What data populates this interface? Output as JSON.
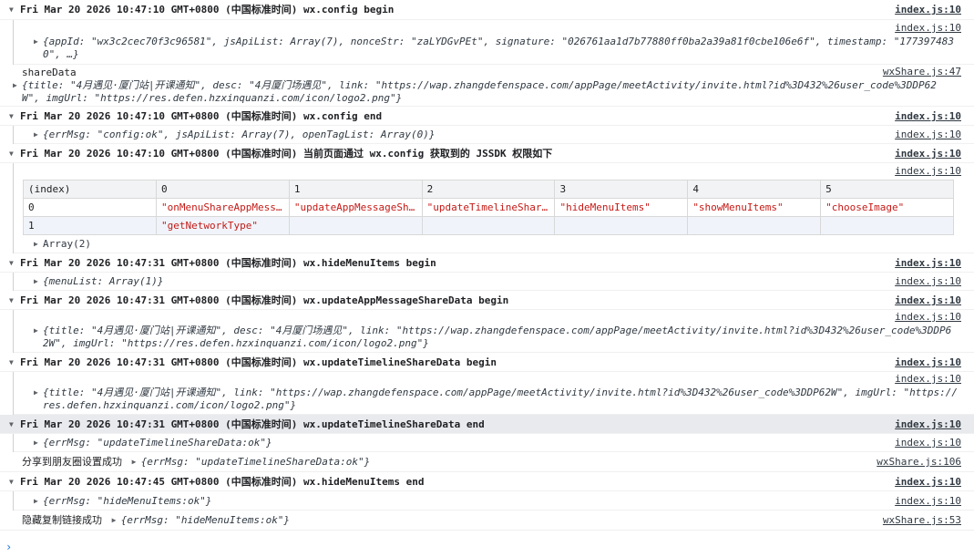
{
  "link_index": "index.js:10",
  "link_wxshare_47": "wxShare.js:47",
  "link_wxshare_106": "wxShare.js:106",
  "link_wxshare_53": "wxShare.js:53",
  "g1": {
    "title": "Fri Mar 20 2026 10:47:10 GMT+0800 (中国标准时间) wx.config begin",
    "obj_line1": "{appId: \"wx3c2cec70f3c96581\", jsApiList: Array(7), nonceStr: \"zaLYDGvPEt\", signature: \"026761aa1d7b77880ff0ba2a39a81f0cbe106e6f\", timestamp: \"177397483",
    "obj_line2": "0\", …}"
  },
  "share": {
    "label": "shareData",
    "obj_line1": "{title: \"4月遇见·厦门站|开课通知\", desc: \"4月厦门场遇见\", link: \"https://wap.zhangdefenspace.com/appPage/meetActivity/invite.html?id%3D432%26user_code%3DDP62",
    "obj_line2": "W\", imgUrl: \"https://res.defen.hzxinquanzi.com/icon/logo2.png\"}"
  },
  "g2": {
    "title": "Fri Mar 20 2026 10:47:10 GMT+0800 (中国标准时间) wx.config end",
    "obj": "{errMsg: \"config:ok\", jsApiList: Array(7), openTagList: Array(0)}"
  },
  "g3": {
    "title": "Fri Mar 20 2026 10:47:10 GMT+0800 (中国标准时间) 当前页面通过 wx.config 获取到的 JSSDK 权限如下",
    "table": {
      "headers": [
        "(index)",
        "0",
        "1",
        "2",
        "3",
        "4",
        "5"
      ],
      "rows": [
        [
          "0",
          "\"onMenuShareAppMess…",
          "\"updateAppMessageSh…",
          "\"updateTimelineShar…",
          "\"hideMenuItems\"",
          "\"showMenuItems\"",
          "\"chooseImage\""
        ],
        [
          "1",
          "\"getNetworkType\"",
          "",
          "",
          "",
          "",
          ""
        ]
      ]
    },
    "array_label": "Array(2)"
  },
  "g4": {
    "title": "Fri Mar 20 2026 10:47:31 GMT+0800 (中国标准时间) wx.hideMenuItems begin",
    "obj": "{menuList: Array(1)}"
  },
  "g5": {
    "title": "Fri Mar 20 2026 10:47:31 GMT+0800 (中国标准时间) wx.updateAppMessageShareData begin",
    "obj_line1": "{title: \"4月遇见·厦门站|开课通知\", desc: \"4月厦门场遇见\", link: \"https://wap.zhangdefenspace.com/appPage/meetActivity/invite.html?id%3D432%26user_code%3DDP6",
    "obj_line2": "2W\", imgUrl: \"https://res.defen.hzxinquanzi.com/icon/logo2.png\"}"
  },
  "g6": {
    "title": "Fri Mar 20 2026 10:47:31 GMT+0800 (中国标准时间) wx.updateTimelineShareData begin",
    "obj_line1": "{title: \"4月遇见·厦门站|开课通知\", link: \"https://wap.zhangdefenspace.com/appPage/meetActivity/invite.html?id%3D432%26user_code%3DDP62W\", imgUrl: \"https://",
    "obj_line2": "res.defen.hzxinquanzi.com/icon/logo2.png\"}"
  },
  "g7": {
    "title": "Fri Mar 20 2026 10:47:31 GMT+0800 (中国标准时间) wx.updateTimelineShareData end",
    "obj": "{errMsg: \"updateTimelineShareData:ok\"}"
  },
  "log1": {
    "text": "分享到朋友圈设置成功",
    "obj": "{errMsg: \"updateTimelineShareData:ok\"}"
  },
  "g8": {
    "title": "Fri Mar 20 2026 10:47:45 GMT+0800 (中国标准时间) wx.hideMenuItems end",
    "obj": "{errMsg: \"hideMenuItems:ok\"}"
  },
  "log2": {
    "text": "隐藏复制链接成功",
    "obj": "{errMsg: \"hideMenuItems:ok\"}"
  },
  "prompt_symbol": "›",
  "icons": {
    "group_toggle": "expand-triangle-down",
    "object_toggle": "expand-triangle-right"
  }
}
